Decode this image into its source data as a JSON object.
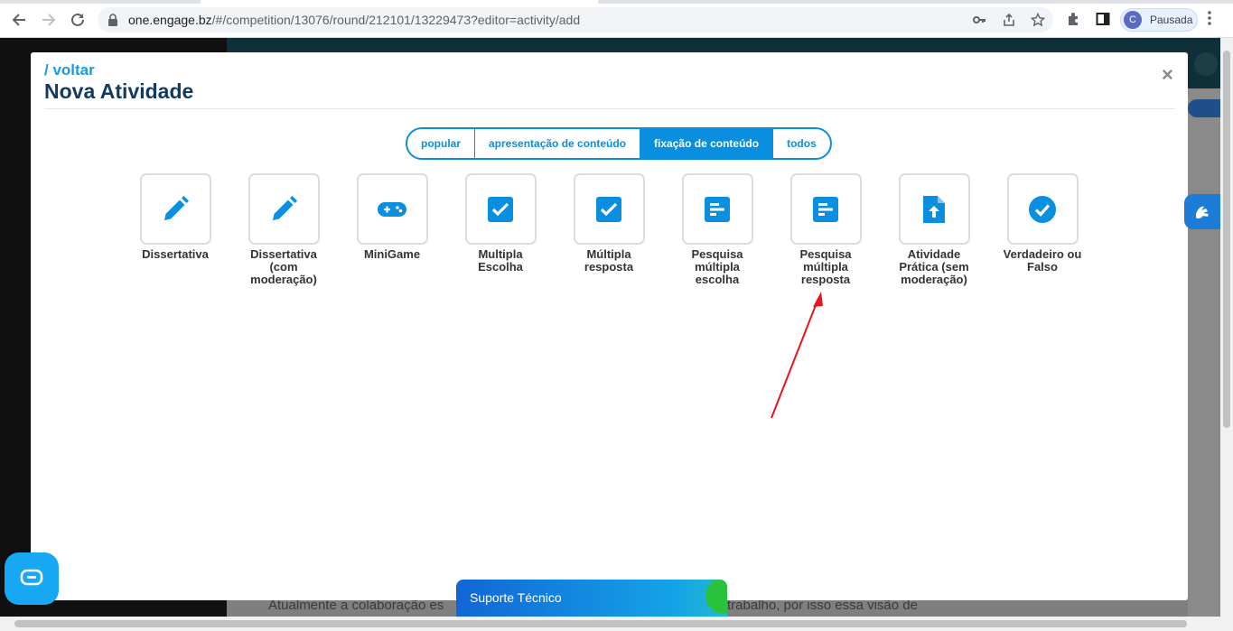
{
  "browser": {
    "url_host": "one.engage.bz",
    "url_path": "/#/competition/13076/round/212101/13229473?editor=activity/add",
    "profile_initial": "C",
    "profile_status": "Pausada"
  },
  "modal": {
    "back_label": "/ voltar",
    "title": "Nova Atividade",
    "close_label": "×",
    "tabs": [
      {
        "label": "popular",
        "active": false
      },
      {
        "label": "apresentação de conteúdo",
        "active": false
      },
      {
        "label": "fixação de conteúdo",
        "active": true
      },
      {
        "label": "todos",
        "active": false
      }
    ],
    "activities": [
      {
        "label": "Dissertativa",
        "icon": "pencil-icon"
      },
      {
        "label": "Dissertativa (com moderação)",
        "icon": "pencil-icon"
      },
      {
        "label": "MiniGame",
        "icon": "gamepad-icon"
      },
      {
        "label": "Multipla Escolha",
        "icon": "checkbox-icon"
      },
      {
        "label": "Múltipla resposta",
        "icon": "checkbox-icon"
      },
      {
        "label": "Pesquisa múltipla escolha",
        "icon": "poll-icon"
      },
      {
        "label": "Pesquisa múltipla resposta",
        "icon": "poll-icon"
      },
      {
        "label": "Atividade Prática (sem moderação)",
        "icon": "file-upload-icon"
      },
      {
        "label": "Verdadeiro ou Falso",
        "icon": "check-circle-icon"
      }
    ]
  },
  "background": {
    "text_left": "Atualmente a colaboração es",
    "text_right": "trabalho, por isso essa visão de"
  },
  "support": {
    "label": "Suporte Técnico"
  },
  "colors": {
    "accent": "#0a8fe0",
    "title": "#123a63",
    "annotation_arrow": "#e8141b"
  }
}
